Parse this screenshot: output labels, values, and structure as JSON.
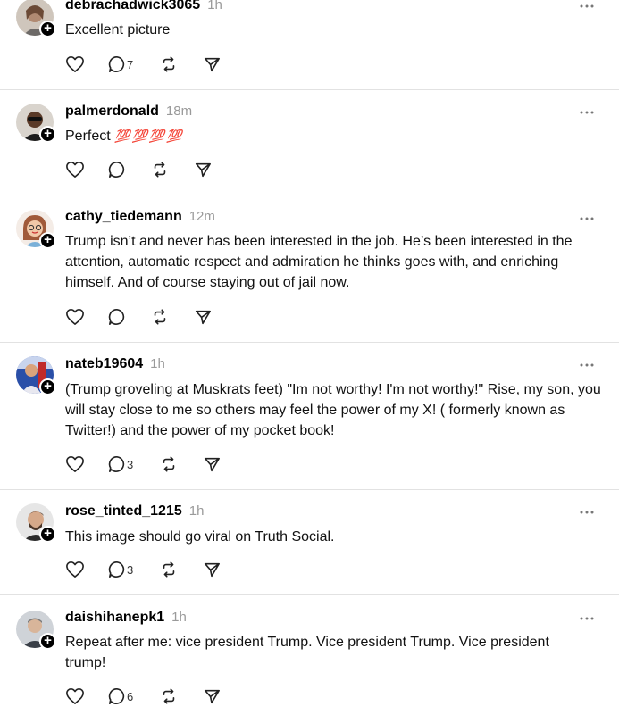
{
  "posts": [
    {
      "username": "debrachadwick3065",
      "time": "1h",
      "text": "Excellent picture",
      "reply_count": "7",
      "repost_count": "",
      "avatar_icon": "user-avatar-photo"
    },
    {
      "username": "palmerdonald",
      "time": "18m",
      "text": "Perfect",
      "emoji": "💯 💯 💯 💯",
      "reply_count": "",
      "avatar_icon": "user-avatar-photo"
    },
    {
      "username": "cathy_tiedemann",
      "time": "12m",
      "text": "Trump isn’t and never has been interested in the job. He’s been interested in the attention, automatic respect and admiration he thinks goes with, and enriching himself. And of course staying out of jail now.",
      "reply_count": "",
      "avatar_icon": "cartoon-avatar"
    },
    {
      "username": "nateb19604",
      "time": "1h",
      "text": "(Trump groveling at Muskrats feet) \"Im not worthy! I'm not worthy!\" Rise, my son, you will stay close to me so others may feel the power of my X! ( formerly known as Twitter!) and the power of my pocket book!",
      "reply_count": "3",
      "avatar_icon": "user-avatar-photo"
    },
    {
      "username": "rose_tinted_1215",
      "time": "1h",
      "text": "This image should go viral on Truth Social.",
      "reply_count": "3",
      "avatar_icon": "user-avatar-photo"
    },
    {
      "username": "daishihanepk1",
      "time": "1h",
      "text": "Repeat after me: vice president Trump. Vice president Trump. Vice president trump!",
      "reply_count": "6",
      "avatar_icon": "user-avatar-photo"
    }
  ],
  "colors": {
    "divider": "#e2e2e2",
    "timestamp": "#9a9a9a",
    "icon": "#222222"
  }
}
